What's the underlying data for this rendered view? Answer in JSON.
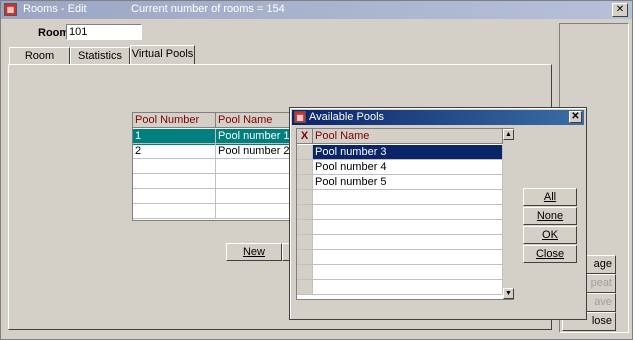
{
  "window": {
    "title": "Rooms - Edit",
    "subtitle": "Current number of rooms = 154",
    "close_glyph": "✕",
    "icon": "app-icon"
  },
  "room": {
    "label": "Room",
    "value": "101"
  },
  "tabs": [
    {
      "label": "Room",
      "active": false
    },
    {
      "label": "Statistics",
      "active": false
    },
    {
      "label": "Virtual Pools",
      "active": true
    }
  ],
  "pools_table": {
    "headers": [
      "Pool Number",
      "Pool Name"
    ],
    "rows": [
      {
        "number": "1",
        "name": "Pool number 1",
        "selected": true
      },
      {
        "number": "2",
        "name": "Pool number 2",
        "selected": false
      }
    ]
  },
  "buttons": {
    "new_label": "New"
  },
  "right_buttons_partial": [
    "age",
    "peat",
    "ave",
    "lose"
  ],
  "dialog": {
    "title": "Available Pools",
    "close_glyph": "✕",
    "header_mark": "X",
    "header_label": "Pool Name",
    "rows": [
      {
        "name": "Pool number 3",
        "selected": true
      },
      {
        "name": "Pool number 4",
        "selected": false
      },
      {
        "name": "Pool number 5",
        "selected": false
      }
    ],
    "buttons": {
      "all": "All",
      "none": "None",
      "ok": "OK",
      "close": "Close"
    }
  },
  "colors": {
    "selected_row_main": "#007f7f",
    "selected_row_dialog": "#0a246a",
    "header_text": "#800000"
  }
}
